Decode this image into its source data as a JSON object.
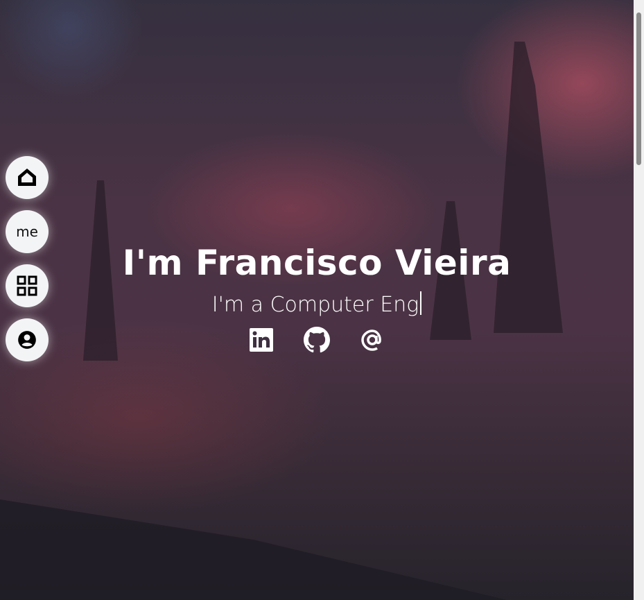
{
  "hero": {
    "title": "I'm Francisco Vieira",
    "subtitle_prefix": "I'm a",
    "subtitle_typed": "Computer Eng"
  },
  "social": [
    {
      "icon": "linkedin-icon"
    },
    {
      "icon": "github-icon"
    },
    {
      "icon": "at-email-icon"
    }
  ],
  "nav": {
    "me_label": "me"
  }
}
